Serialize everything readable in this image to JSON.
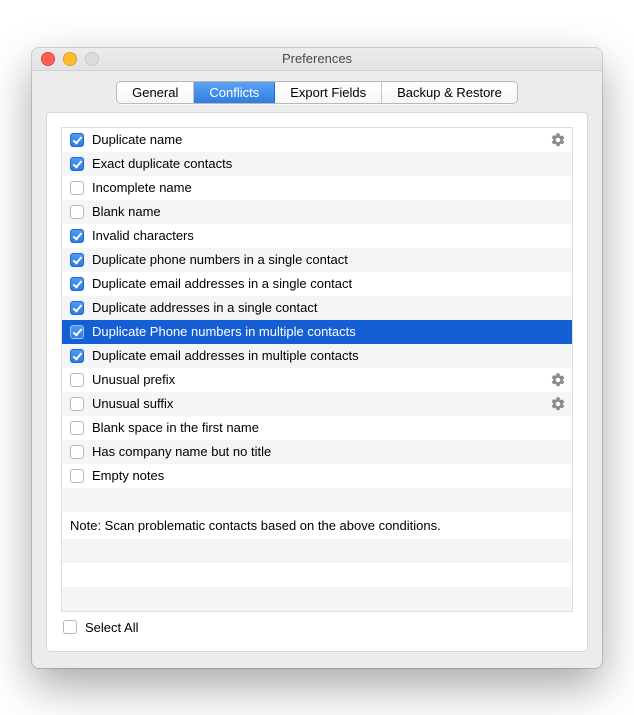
{
  "window": {
    "title": "Preferences"
  },
  "tabs": {
    "items": [
      {
        "label": "General"
      },
      {
        "label": "Conflicts"
      },
      {
        "label": "Export Fields"
      },
      {
        "label": "Backup & Restore"
      }
    ],
    "active_index": 1
  },
  "conflicts": {
    "rows": [
      {
        "label": "Duplicate name",
        "checked": true,
        "gear": true
      },
      {
        "label": "Exact duplicate contacts",
        "checked": true,
        "gear": false
      },
      {
        "label": "Incomplete name",
        "checked": false,
        "gear": false
      },
      {
        "label": "Blank name",
        "checked": false,
        "gear": false
      },
      {
        "label": "Invalid characters",
        "checked": true,
        "gear": false
      },
      {
        "label": "Duplicate phone numbers in a single contact",
        "checked": true,
        "gear": false
      },
      {
        "label": "Duplicate email addresses in a single contact",
        "checked": true,
        "gear": false
      },
      {
        "label": "Duplicate addresses in a single contact",
        "checked": true,
        "gear": false
      },
      {
        "label": "Duplicate Phone numbers in multiple contacts",
        "checked": true,
        "gear": false,
        "selected": true
      },
      {
        "label": "Duplicate email addresses in multiple contacts",
        "checked": true,
        "gear": false
      },
      {
        "label": "Unusual prefix",
        "checked": false,
        "gear": true
      },
      {
        "label": "Unusual suffix",
        "checked": false,
        "gear": true
      },
      {
        "label": "Blank space in the first name",
        "checked": false,
        "gear": false
      },
      {
        "label": "Has company name but no title",
        "checked": false,
        "gear": false
      },
      {
        "label": "Empty notes",
        "checked": false,
        "gear": false
      }
    ],
    "note": "Note: Scan problematic contacts based on the above conditions.",
    "select_all": {
      "label": "Select All",
      "checked": false
    }
  }
}
